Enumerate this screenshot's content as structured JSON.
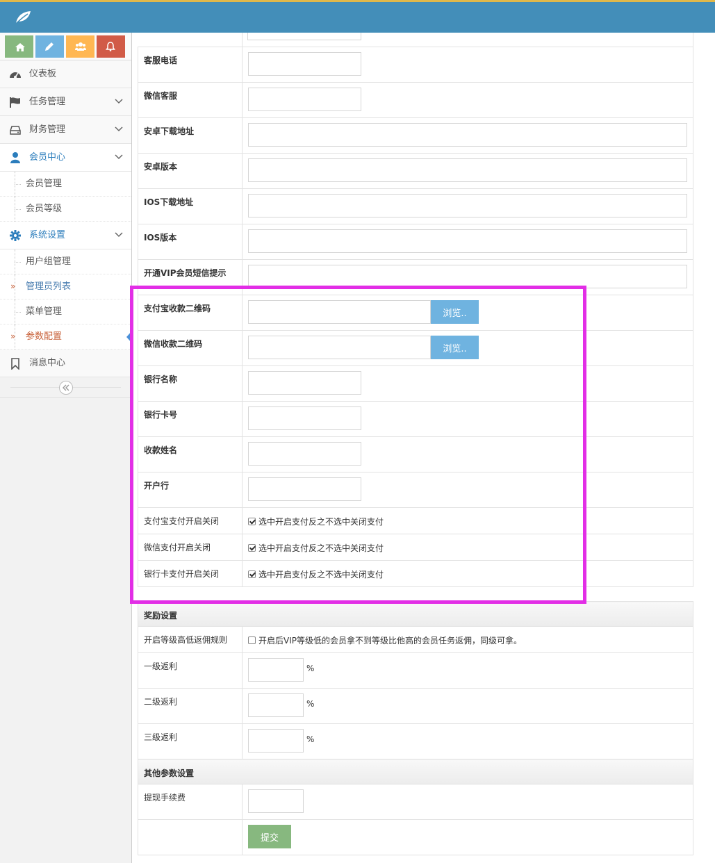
{
  "sidebar": {
    "menu": [
      {
        "label": "仪表板"
      },
      {
        "label": "任务管理"
      },
      {
        "label": "财务管理"
      },
      {
        "label": "会员中心",
        "children": [
          "会员管理",
          "会员等级"
        ]
      },
      {
        "label": "系统设置",
        "children": [
          "用户组管理",
          "管理员列表",
          "菜单管理",
          "参数配置"
        ]
      },
      {
        "label": "消息中心"
      }
    ]
  },
  "form": {
    "customer_phone": "客服电话",
    "wechat_service": "微信客服",
    "android_url": "安卓下载地址",
    "android_version": "安卓版本",
    "ios_url": "IOS下载地址",
    "ios_version": "IOS版本",
    "vip_sms": "开通VIP会员短信提示",
    "alipay_qr": "支付宝收款二维码",
    "wechat_qr": "微信收款二维码",
    "browse_label": "浏览..",
    "bank_name": "银行名称",
    "bank_card": "银行卡号",
    "payee_name": "收款姓名",
    "bank_branch": "开户行",
    "alipay_toggle": "支付宝支付开启关闭",
    "wechat_toggle": "微信支付开启关闭",
    "bankcard_toggle": "银行卡支付开启关闭",
    "toggle_hint": "选中开启支付反之不选中关闭支付",
    "reward_section": "奖励设置",
    "level_rule": "开启等级高低返佣规则",
    "level_rule_hint": "开启后VIP等级低的会员拿不到等级比他高的会员任务返佣，同级可拿。",
    "level1": "一级返利",
    "level2": "二级返利",
    "level3": "三级返利",
    "percent": "%",
    "other_section": "其他参数设置",
    "withdraw_fee": "提现手续费",
    "submit": "提交"
  },
  "colors": {
    "navbar": "#438eb9",
    "highlight": "#e22ee6",
    "browse": "#6fb3e0",
    "submit": "#87b87f"
  }
}
